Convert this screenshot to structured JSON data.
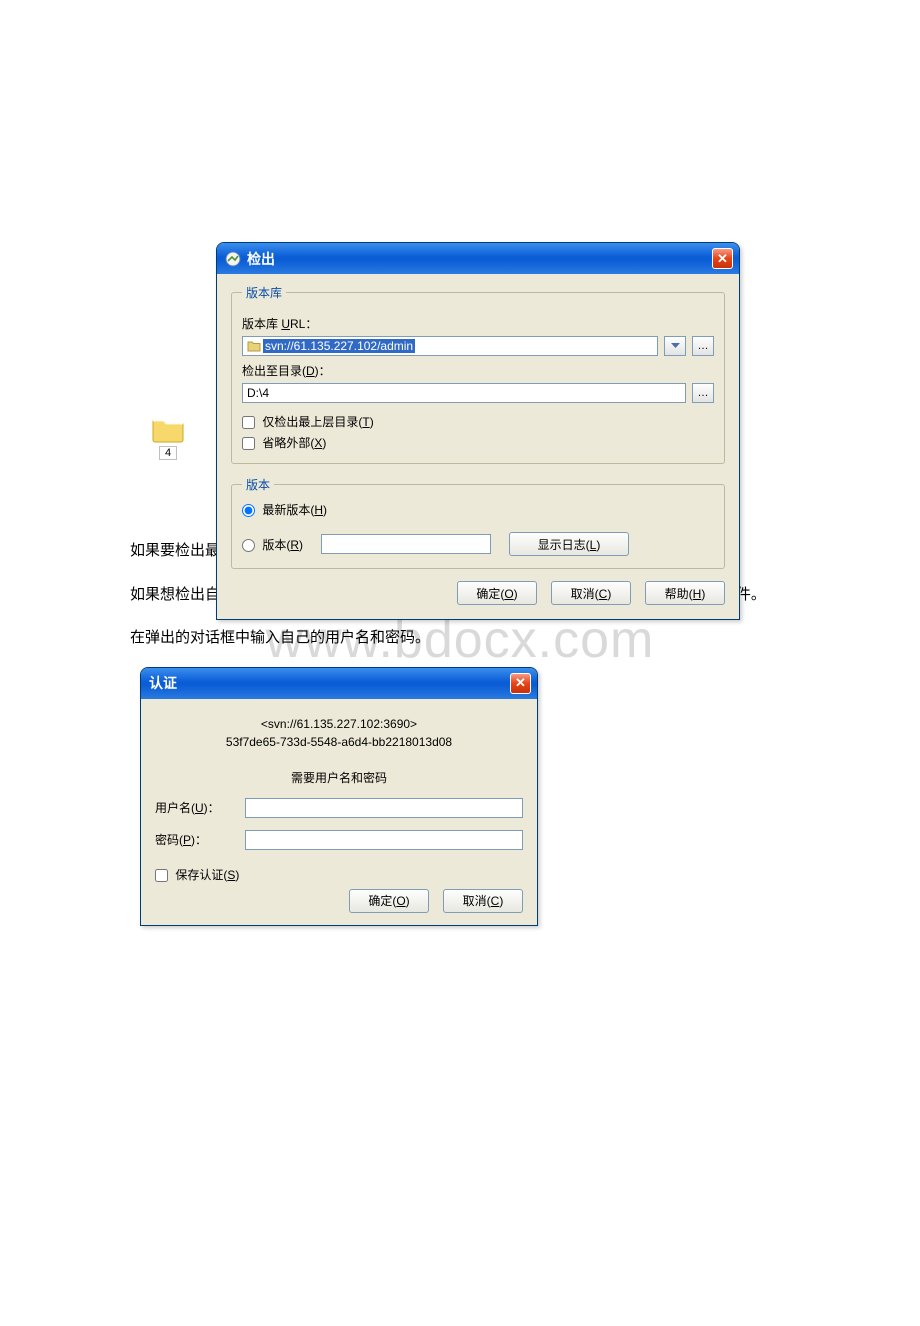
{
  "watermark": "www.bdocx.com",
  "folder": {
    "label": "4"
  },
  "checkout": {
    "title": "检出",
    "group_repo": {
      "legend": "版本库",
      "url_label_pre": "版本库 ",
      "url_label_u": "U",
      "url_label_post": "RL：",
      "url_value": "svn://61.135.227.102/admin",
      "dir_label_pre": "检出至目录(",
      "dir_label_u": "D",
      "dir_label_post": ")：",
      "dir_value": "D:\\4",
      "cb_top_pre": "仅检出最上层目录(",
      "cb_top_u": "T",
      "cb_top_post": ")",
      "cb_ext_pre": "省略外部(",
      "cb_ext_u": "X",
      "cb_ext_post": ")"
    },
    "group_rev": {
      "legend": "版本",
      "radio_head_pre": "最新版本(",
      "radio_head_u": "H",
      "radio_head_post": ")",
      "radio_rev_pre": "版本(",
      "radio_rev_u": "R",
      "radio_rev_post": ")",
      "showlog_pre": "显示日志(",
      "showlog_u": "L",
      "showlog_post": ")"
    },
    "buttons": {
      "ok_pre": "确定(",
      "ok_u": "O",
      "ok_post": ")",
      "cancel_pre": "取消(",
      "cancel_u": "C",
      "cancel_post": ")",
      "help_pre": "帮助(",
      "help_u": "H",
      "help_post": ")"
    }
  },
  "paragraphs": {
    "p1": "如果要检出最新的版本可选中上图的（最新版本(H)）单选按钮。",
    "p2": "如果想检出自己需要的版本可选中上图的（版本(R)）单选按钮，然后选择自己需要的版本文件。",
    "p3": "在弹出的对话框中输入自己的用户名和密码。"
  },
  "auth": {
    "title": "认证",
    "line1": "<svn://61.135.227.102:3690>",
    "line2": "53f7de65-733d-5548-a6d4-bb2218013d08",
    "need": "需要用户名和密码",
    "user_pre": "用户名(",
    "user_u": "U",
    "user_post": ")：",
    "pass_pre": "密码(",
    "pass_u": "P",
    "pass_post": ")：",
    "save_pre": "保存认证(",
    "save_u": "S",
    "save_post": ")",
    "ok_pre": "确定(",
    "ok_u": "O",
    "ok_post": ")",
    "cancel_pre": "取消(",
    "cancel_u": "C",
    "cancel_post": ")"
  }
}
